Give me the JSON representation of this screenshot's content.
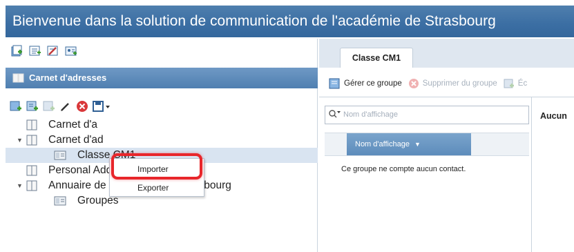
{
  "title": "Bienvenue dans la solution de communication de l'académie de Strasbourg",
  "left_pane": {
    "toolbar1_icons": [
      "new-contact-icon",
      "new-list-icon",
      "edit-list-icon",
      "address-card-icon"
    ],
    "header": {
      "icon": "address-book-icon",
      "label": "Carnet d'adresses"
    },
    "toolbar2_icons": [
      "add-contact-icon",
      "add-group-icon",
      "disabled-add-icon",
      "pencil-icon",
      "delete-icon",
      "import-export-icon"
    ],
    "tree": [
      {
        "label": "Carnet d'a",
        "indent": 0,
        "expanded": null,
        "icon": "address-book-icon",
        "selected": false
      },
      {
        "label": "Carnet d'ad",
        "indent": 0,
        "expanded": true,
        "icon": "address-book-icon",
        "selected": false
      },
      {
        "label": "Classe CM1",
        "indent": 1,
        "expanded": null,
        "icon": "group-icon",
        "selected": true
      },
      {
        "label": "Personal Address Book",
        "indent": 0,
        "expanded": null,
        "icon": "address-book-icon",
        "selected": false
      },
      {
        "label": "Annuaire de l'Academie de Strasbourg",
        "indent": 0,
        "expanded": true,
        "icon": "address-book-icon",
        "selected": false
      },
      {
        "label": "Groupes",
        "indent": 1,
        "expanded": null,
        "icon": "group-icon",
        "selected": false
      }
    ],
    "dropdown": {
      "items": [
        "Importer",
        "Exporter"
      ],
      "highlighted": "Importer",
      "highlight_color": "#e8262b"
    }
  },
  "right_pane": {
    "tab": "Classe CM1",
    "toolbar": {
      "manage_group": "Gérer ce groupe",
      "remove_from_group": "Supprimer du groupe",
      "truncated_action": "Éc"
    },
    "search_placeholder": "Nom d'affichage",
    "column_header": "Nom d'affichage",
    "empty_message": "Ce groupe ne compte aucun contact.",
    "details_label": "Aucun"
  },
  "colors": {
    "titlebar": "#3b6ea3",
    "section_header": "#5d8cbb",
    "selected_row": "#d9e4f1"
  }
}
